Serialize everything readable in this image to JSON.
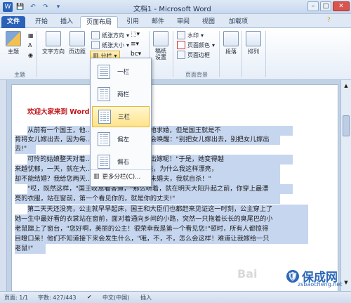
{
  "window": {
    "title": "文档1 - Microsoft Word",
    "controls": [
      "–",
      "□",
      "✕"
    ]
  },
  "tabs": [
    {
      "label": "文件",
      "active": false
    },
    {
      "label": "开始",
      "active": false
    },
    {
      "label": "插入",
      "active": false
    },
    {
      "label": "页面布局",
      "active": true
    },
    {
      "label": "引用",
      "active": false
    },
    {
      "label": "邮件",
      "active": false
    },
    {
      "label": "审阅",
      "active": false
    },
    {
      "label": "视图",
      "active": false
    },
    {
      "label": "加载项",
      "active": false
    }
  ],
  "ribbon": {
    "theme_group": {
      "button": "主题",
      "label": "主题"
    },
    "text_direction": "文字方向",
    "margins": "页边距",
    "paper_direction": "纸张方向",
    "paper_size": "纸张大小",
    "columns": "分栏",
    "page_setup_label": "页面设置",
    "manuscript": "稿纸\n设置",
    "watermark": "水印",
    "page_color": "页面颜色",
    "page_border": "页面边框",
    "page_bg_label": "页面背景",
    "paragraph": "段落",
    "arrange": "排列"
  },
  "dropdown": {
    "items": [
      "一栏",
      "两栏",
      "三栏",
      "偏左",
      "偏右"
    ],
    "highlighted": "三栏",
    "more": "更多分栏(C)..."
  },
  "document": {
    "heading": "欢迎大家来到 Word",
    "lines": [
      "从前有一个国王，他……，无数王公大臣向她求婚，但是国王就是不",
      "肯将女儿嫁出去，因为每……女儿的公主，他就会唤醒：\"别把女儿嫁出去，别把女儿嫁出",
      "去!\"",
      "可怜的姑娘整天对着……亮，为什么就不能出嫁呢！\"于是，她变得越",
      "来越忧郁，一天，就在大……对老国王说：\"爸爸，为什么我这样漂亮，",
      "却不能结婚？我给您两天……您还不能给我找个未婚夫，我就自杀！\"",
      "\"哎，既然这样，\"国王叹息着答道，\"那么听着，就在明天大阳升起之前，你穿上最漂",
      "亮的衣服，站在窗前，第一个看见你的，就是你的丈夫!\"",
      "第二天天还没亮，公主就早早起床，国王和大臣们也都赶来见证这一时刻，公主穿上了",
      "她一生中最好看的衣裳站在窗前，面对着通向乡间的小路，突然一只拖着长长的臭尾巴的小",
      "老鼠蹿上了窗台，\"您好啊，美丽的公主！很荣幸我是第一个看见您!\"顿时，所有人都惊得",
      "目瞪口呆！他们不知道接下来会发生什么，\"哦，不，不，怎么会这样！难道让我嫁给一只",
      "老鼠!\""
    ]
  },
  "statusbar": {
    "page": "页面: 1/1",
    "words": "字数: 427/443",
    "language": "中文(中国)",
    "mode": "插入"
  },
  "watermark_text": "Bai",
  "brand": {
    "name": "保成网",
    "url": "zsbaocheng.net"
  },
  "colors": {
    "accent": "#2b62b8",
    "selection": "#c6d6ef",
    "heading": "#c0161b",
    "highlight": "#ffe389"
  }
}
